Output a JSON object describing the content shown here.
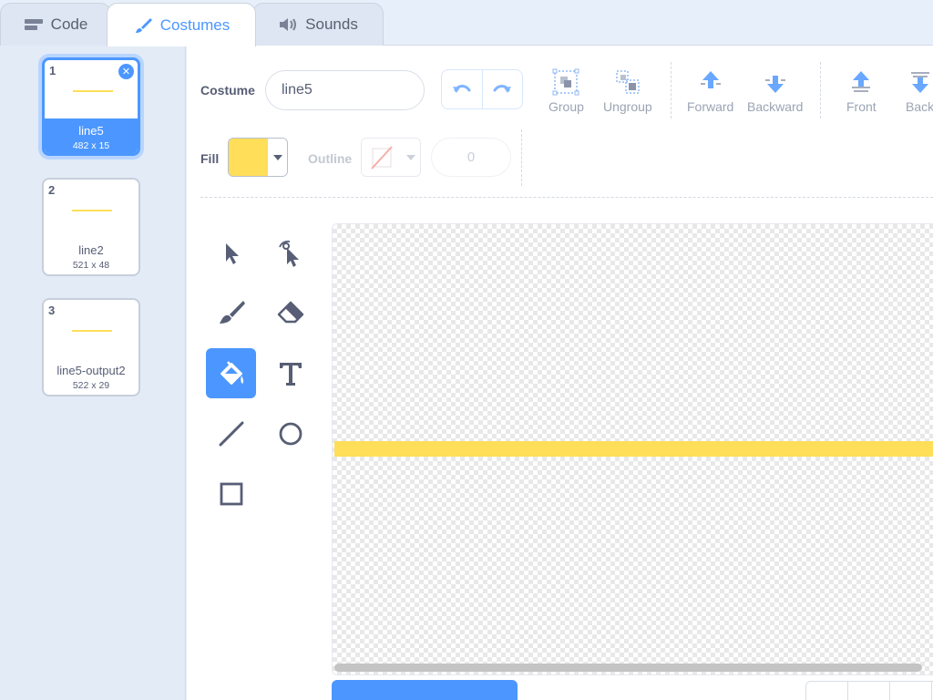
{
  "tabs": [
    {
      "label": "Code",
      "icon": "code-icon"
    },
    {
      "label": "Costumes",
      "icon": "brush-icon",
      "active": true
    },
    {
      "label": "Sounds",
      "icon": "speaker-icon"
    }
  ],
  "costumes": [
    {
      "number": "1",
      "name": "line5",
      "size": "482 x 15",
      "selected": true
    },
    {
      "number": "2",
      "name": "line2",
      "size": "521 x 48"
    },
    {
      "number": "3",
      "name": "line5-output2",
      "size": "522 x 29"
    }
  ],
  "toolbar": {
    "costume_label": "Costume",
    "costume_name": "line5",
    "group": "Group",
    "ungroup": "Ungroup",
    "forward": "Forward",
    "backward": "Backward",
    "front": "Front",
    "back": "Back",
    "fill_label": "Fill",
    "fill_color": "#ffde59",
    "outline_label": "Outline",
    "outline_width": "0"
  },
  "tools": [
    "select-tool",
    "reshape-tool",
    "brush-tool",
    "eraser-tool",
    "fill-tool",
    "text-tool",
    "line-tool",
    "circle-tool",
    "rectangle-tool"
  ],
  "active_tool": "fill-tool",
  "colors": {
    "accent": "#4c97ff",
    "fill": "#ffde59"
  }
}
